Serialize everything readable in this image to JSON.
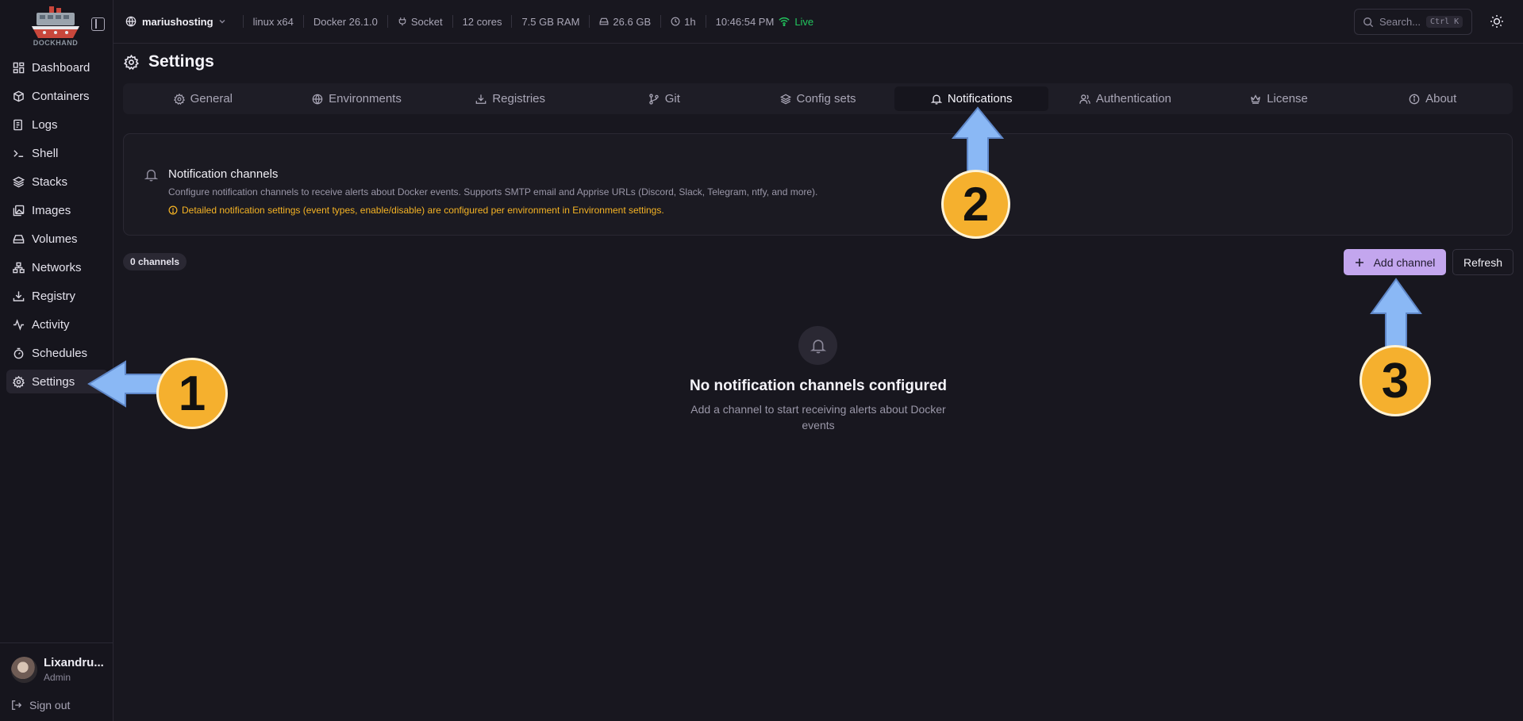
{
  "app": {
    "logo_text": "DOCKHAND"
  },
  "sidebar": {
    "items": [
      {
        "label": "Dashboard",
        "icon": "grid-icon"
      },
      {
        "label": "Containers",
        "icon": "box-icon"
      },
      {
        "label": "Logs",
        "icon": "logs-icon"
      },
      {
        "label": "Shell",
        "icon": "terminal-icon"
      },
      {
        "label": "Stacks",
        "icon": "layers-icon"
      },
      {
        "label": "Images",
        "icon": "images-icon"
      },
      {
        "label": "Volumes",
        "icon": "hard-drive-icon"
      },
      {
        "label": "Networks",
        "icon": "network-icon"
      },
      {
        "label": "Registry",
        "icon": "download-icon"
      },
      {
        "label": "Activity",
        "icon": "activity-icon"
      },
      {
        "label": "Schedules",
        "icon": "timer-icon"
      },
      {
        "label": "Settings",
        "icon": "gear-icon",
        "active": true
      }
    ],
    "user": {
      "name": "Lixandru...",
      "role": "Admin"
    },
    "signout_label": "Sign out"
  },
  "topbar": {
    "environment": "mariushosting",
    "os": "linux x64",
    "docker": "Docker 26.1.0",
    "connection": "Socket",
    "cores": "12 cores",
    "ram": "7.5 GB RAM",
    "disk": "26.6 GB",
    "uptime": "1h",
    "time": "10:46:54 PM",
    "live": "Live",
    "search_placeholder": "Search...",
    "search_shortcut": "Ctrl K"
  },
  "page": {
    "title": "Settings"
  },
  "tabs": [
    {
      "label": "General",
      "icon": "gear-icon"
    },
    {
      "label": "Environments",
      "icon": "globe-icon"
    },
    {
      "label": "Registries",
      "icon": "download-icon"
    },
    {
      "label": "Git",
      "icon": "git-branch-icon"
    },
    {
      "label": "Config sets",
      "icon": "layers-icon"
    },
    {
      "label": "Notifications",
      "icon": "bell-icon",
      "active": true
    },
    {
      "label": "Authentication",
      "icon": "users-icon"
    },
    {
      "label": "License",
      "icon": "crown-icon"
    },
    {
      "label": "About",
      "icon": "info-icon"
    }
  ],
  "notifications": {
    "card_title": "Notification channels",
    "card_desc": "Configure notification channels to receive alerts about Docker events. Supports SMTP email and Apprise URLs (Discord, Slack, Telegram, ntfy, and more).",
    "card_warning": "Detailed notification settings (event types, enable/disable) are configured per environment in Environment settings.",
    "count": "0 channels",
    "add_label": "Add channel",
    "refresh_label": "Refresh",
    "empty_title": "No notification channels configured",
    "empty_desc": "Add a channel to start receiving alerts about Docker events"
  },
  "annotations": {
    "step1": "1",
    "step2": "2",
    "step3": "3"
  },
  "colors": {
    "accent": "#c3a6ee",
    "warning": "#f5b324",
    "live": "#22c55e",
    "annotation_arrow": "#8ab8f5",
    "annotation_badge": "#f5b02e"
  }
}
